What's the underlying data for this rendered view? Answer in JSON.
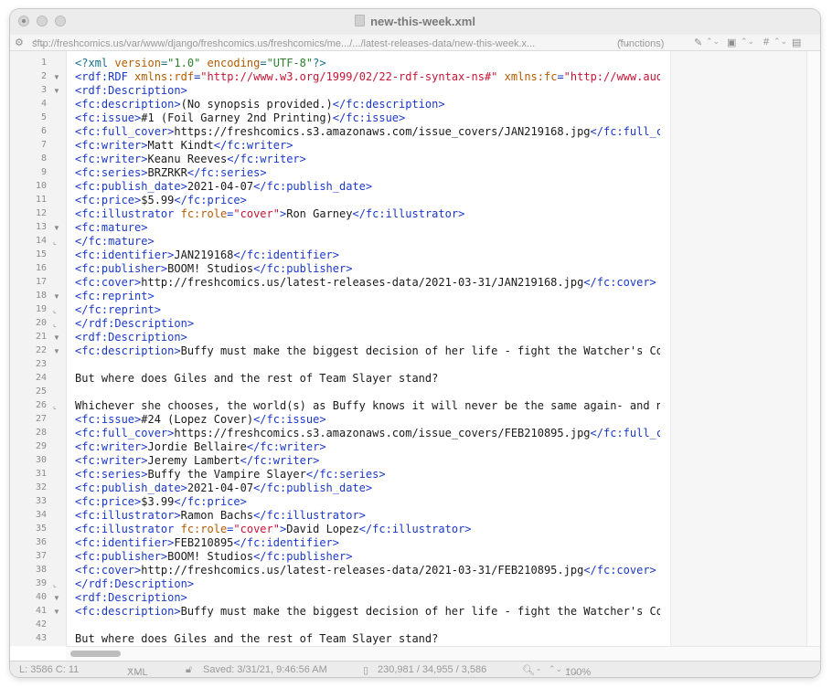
{
  "window": {
    "title": "new-this-week.xml"
  },
  "navbar": {
    "path": "sftp://freshcomics.us/var/www/django/freshcomics.us/freshcomics/me.../.../latest-releases-data/new-this-week.x...",
    "functions": "(functions)",
    "hash": "#"
  },
  "lines": [
    {
      "n": "1",
      "fold": "",
      "segs": [
        [
          "pi",
          "<?xml "
        ],
        [
          "attr",
          "version"
        ],
        [
          "pi",
          "="
        ],
        [
          "pval",
          "\"1.0\""
        ],
        [
          "pi",
          " "
        ],
        [
          "attr",
          "encoding"
        ],
        [
          "pi",
          "="
        ],
        [
          "pval",
          "\"UTF-8\""
        ],
        [
          "pi",
          "?>"
        ]
      ]
    },
    {
      "n": "2",
      "fold": "▼",
      "segs": [
        [
          "tag",
          "<rdf:RDF "
        ],
        [
          "attr",
          "xmlns:rdf"
        ],
        [
          "tag",
          "="
        ],
        [
          "val",
          "\"http://www.w3.org/1999/02/22-rdf-syntax-ns#\""
        ],
        [
          "tag",
          " "
        ],
        [
          "attr",
          "xmlns:fc"
        ],
        [
          "tag",
          "="
        ],
        [
          "val",
          "\"http://www.audacious-software.com/fr"
        ]
      ]
    },
    {
      "n": "3",
      "fold": "▼",
      "segs": [
        [
          "tag",
          "<rdf:Description>"
        ]
      ]
    },
    {
      "n": "4",
      "fold": "",
      "segs": [
        [
          "tag",
          "<fc:description>"
        ],
        [
          "txt",
          "(No synopsis provided.)"
        ],
        [
          "tag",
          "</fc:description>"
        ]
      ]
    },
    {
      "n": "5",
      "fold": "",
      "segs": [
        [
          "tag",
          "<fc:issue>"
        ],
        [
          "txt",
          "#1 (Foil Garney 2nd Printing)"
        ],
        [
          "tag",
          "</fc:issue>"
        ]
      ]
    },
    {
      "n": "6",
      "fold": "",
      "segs": [
        [
          "tag",
          "<fc:full_cover>"
        ],
        [
          "txt",
          "https://freshcomics.s3.amazonaws.com/issue_covers/JAN219168.jpg"
        ],
        [
          "tag",
          "</fc:full_cover>"
        ]
      ]
    },
    {
      "n": "7",
      "fold": "",
      "segs": [
        [
          "tag",
          "<fc:writer>"
        ],
        [
          "txt",
          "Matt Kindt"
        ],
        [
          "tag",
          "</fc:writer>"
        ]
      ]
    },
    {
      "n": "8",
      "fold": "",
      "segs": [
        [
          "tag",
          "<fc:writer>"
        ],
        [
          "txt",
          "Keanu Reeves"
        ],
        [
          "tag",
          "</fc:writer>"
        ]
      ]
    },
    {
      "n": "9",
      "fold": "",
      "segs": [
        [
          "tag",
          "<fc:series>"
        ],
        [
          "txt",
          "BRZRKR"
        ],
        [
          "tag",
          "</fc:series>"
        ]
      ]
    },
    {
      "n": "10",
      "fold": "",
      "segs": [
        [
          "tag",
          "<fc:publish_date>"
        ],
        [
          "txt",
          "2021-04-07"
        ],
        [
          "tag",
          "</fc:publish_date>"
        ]
      ]
    },
    {
      "n": "11",
      "fold": "",
      "segs": [
        [
          "tag",
          "<fc:price>"
        ],
        [
          "txt",
          "$5.99"
        ],
        [
          "tag",
          "</fc:price>"
        ]
      ]
    },
    {
      "n": "12",
      "fold": "",
      "segs": [
        [
          "tag",
          "<fc:illustrator "
        ],
        [
          "attr",
          "fc:role"
        ],
        [
          "tag",
          "="
        ],
        [
          "val",
          "\"cover\""
        ],
        [
          "tag",
          ">"
        ],
        [
          "txt",
          "Ron Garney"
        ],
        [
          "tag",
          "</fc:illustrator>"
        ]
      ]
    },
    {
      "n": "13",
      "fold": "▼",
      "segs": [
        [
          "tag",
          "<fc:mature>"
        ]
      ]
    },
    {
      "n": "14",
      "fold": "⌞",
      "segs": [
        [
          "tag",
          "</fc:mature>"
        ]
      ]
    },
    {
      "n": "15",
      "fold": "",
      "segs": [
        [
          "tag",
          "<fc:identifier>"
        ],
        [
          "txt",
          "JAN219168"
        ],
        [
          "tag",
          "</fc:identifier>"
        ]
      ]
    },
    {
      "n": "16",
      "fold": "",
      "segs": [
        [
          "tag",
          "<fc:publisher>"
        ],
        [
          "txt",
          "BOOM! Studios"
        ],
        [
          "tag",
          "</fc:publisher>"
        ]
      ]
    },
    {
      "n": "17",
      "fold": "",
      "segs": [
        [
          "tag",
          "<fc:cover>"
        ],
        [
          "txt",
          "http://freshcomics.us/latest-releases-data/2021-03-31/JAN219168.jpg"
        ],
        [
          "tag",
          "</fc:cover>"
        ]
      ]
    },
    {
      "n": "18",
      "fold": "▼",
      "segs": [
        [
          "tag",
          "<fc:reprint>"
        ]
      ]
    },
    {
      "n": "19",
      "fold": "⌞",
      "segs": [
        [
          "tag",
          "</fc:reprint>"
        ]
      ]
    },
    {
      "n": "20",
      "fold": "⌞",
      "segs": [
        [
          "tag",
          "</rdf:Description>"
        ]
      ]
    },
    {
      "n": "21",
      "fold": "▼",
      "segs": [
        [
          "tag",
          "<rdf:Description>"
        ]
      ]
    },
    {
      "n": "22",
      "fold": "▼",
      "segs": [
        [
          "tag",
          "<fc:description>"
        ],
        [
          "txt",
          "Buffy must make the biggest decision of her life - fight the Watcher's Council or save the worl"
        ]
      ]
    },
    {
      "n": "23",
      "fold": "",
      "segs": []
    },
    {
      "n": "24",
      "fold": "",
      "segs": [
        [
          "txt",
          "But where does Giles and the rest of Team Slayer stand?"
        ]
      ]
    },
    {
      "n": "25",
      "fold": "",
      "segs": []
    },
    {
      "n": "26",
      "fold": "⌞",
      "segs": [
        [
          "txt",
          "Whichever she chooses, the world(s) as Buffy knows it will never be the same again- and neither will the Scooby"
        ]
      ]
    },
    {
      "n": "27",
      "fold": "",
      "segs": [
        [
          "tag",
          "<fc:issue>"
        ],
        [
          "txt",
          "#24 (Lopez Cover)"
        ],
        [
          "tag",
          "</fc:issue>"
        ]
      ]
    },
    {
      "n": "28",
      "fold": "",
      "segs": [
        [
          "tag",
          "<fc:full_cover>"
        ],
        [
          "txt",
          "https://freshcomics.s3.amazonaws.com/issue_covers/FEB210895.jpg"
        ],
        [
          "tag",
          "</fc:full_cover>"
        ]
      ]
    },
    {
      "n": "29",
      "fold": "",
      "segs": [
        [
          "tag",
          "<fc:writer>"
        ],
        [
          "txt",
          "Jordie Bellaire"
        ],
        [
          "tag",
          "</fc:writer>"
        ]
      ]
    },
    {
      "n": "30",
      "fold": "",
      "segs": [
        [
          "tag",
          "<fc:writer>"
        ],
        [
          "txt",
          "Jeremy Lambert"
        ],
        [
          "tag",
          "</fc:writer>"
        ]
      ]
    },
    {
      "n": "31",
      "fold": "",
      "segs": [
        [
          "tag",
          "<fc:series>"
        ],
        [
          "txt",
          "Buffy the Vampire Slayer"
        ],
        [
          "tag",
          "</fc:series>"
        ]
      ]
    },
    {
      "n": "32",
      "fold": "",
      "segs": [
        [
          "tag",
          "<fc:publish_date>"
        ],
        [
          "txt",
          "2021-04-07"
        ],
        [
          "tag",
          "</fc:publish_date>"
        ]
      ]
    },
    {
      "n": "33",
      "fold": "",
      "segs": [
        [
          "tag",
          "<fc:price>"
        ],
        [
          "txt",
          "$3.99"
        ],
        [
          "tag",
          "</fc:price>"
        ]
      ]
    },
    {
      "n": "34",
      "fold": "",
      "segs": [
        [
          "tag",
          "<fc:illustrator>"
        ],
        [
          "txt",
          "Ramon Bachs"
        ],
        [
          "tag",
          "</fc:illustrator>"
        ]
      ]
    },
    {
      "n": "35",
      "fold": "",
      "segs": [
        [
          "tag",
          "<fc:illustrator "
        ],
        [
          "attr",
          "fc:role"
        ],
        [
          "tag",
          "="
        ],
        [
          "val",
          "\"cover\""
        ],
        [
          "tag",
          ">"
        ],
        [
          "txt",
          "David Lopez"
        ],
        [
          "tag",
          "</fc:illustrator>"
        ]
      ]
    },
    {
      "n": "36",
      "fold": "",
      "segs": [
        [
          "tag",
          "<fc:identifier>"
        ],
        [
          "txt",
          "FEB210895"
        ],
        [
          "tag",
          "</fc:identifier>"
        ]
      ]
    },
    {
      "n": "37",
      "fold": "",
      "segs": [
        [
          "tag",
          "<fc:publisher>"
        ],
        [
          "txt",
          "BOOM! Studios"
        ],
        [
          "tag",
          "</fc:publisher>"
        ]
      ]
    },
    {
      "n": "38",
      "fold": "",
      "segs": [
        [
          "tag",
          "<fc:cover>"
        ],
        [
          "txt",
          "http://freshcomics.us/latest-releases-data/2021-03-31/FEB210895.jpg"
        ],
        [
          "tag",
          "</fc:cover>"
        ]
      ]
    },
    {
      "n": "39",
      "fold": "⌞",
      "segs": [
        [
          "tag",
          "</rdf:Description>"
        ]
      ]
    },
    {
      "n": "40",
      "fold": "▼",
      "segs": [
        [
          "tag",
          "<rdf:Description>"
        ]
      ]
    },
    {
      "n": "41",
      "fold": "▼",
      "segs": [
        [
          "tag",
          "<fc:description>"
        ],
        [
          "txt",
          "Buffy must make the biggest decision of her life - fight the Watcher's Council or save the worl"
        ]
      ]
    },
    {
      "n": "42",
      "fold": "",
      "segs": []
    },
    {
      "n": "43",
      "fold": "",
      "segs": [
        [
          "txt",
          "But where does Giles and the rest of Team Slayer stand?"
        ]
      ]
    }
  ],
  "status": {
    "position": "L: 3586 C: 11",
    "language": "XML",
    "saved": "Saved: 3/31/21, 9:46:56 AM",
    "counts": "230,981 / 34,955 / 3,586",
    "search_value": "-",
    "zoom": "100%"
  },
  "icons": {
    "gear": "gear-icon",
    "pen": "pen-icon",
    "clipboard": "clipboard-icon",
    "document": "document-icon",
    "lock": "lock-icon",
    "magnifier": "magnifier-icon"
  },
  "colors": {
    "tag": "#1a38c8",
    "attribute": "#b35a00",
    "value": "#c71535",
    "processing_instruction": "#18708a"
  }
}
